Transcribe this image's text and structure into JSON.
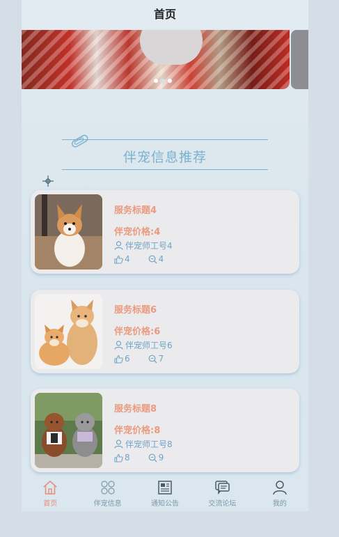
{
  "header": {
    "title": "首页"
  },
  "banner": {
    "slide_count": 3,
    "active_index": 1
  },
  "section": {
    "title": "伴宠信息推荐"
  },
  "cards": [
    {
      "title": "服务标题4",
      "price": "伴宠价格:4",
      "staff": "伴宠师工号4",
      "likes": "4",
      "views": "4",
      "image": "corgi-photo"
    },
    {
      "title": "服务标题6",
      "price": "伴宠价格:6",
      "staff": "伴宠师工号6",
      "likes": "6",
      "views": "7",
      "image": "kittens-photo"
    },
    {
      "title": "服务标题8",
      "price": "伴宠价格:8",
      "staff": "伴宠师工号8",
      "likes": "8",
      "views": "9",
      "image": "poodles-photo"
    }
  ],
  "tabbar": {
    "items": [
      {
        "label": "首页",
        "icon": "home-icon",
        "active": true
      },
      {
        "label": "伴宠信息",
        "icon": "grid-icon",
        "active": false
      },
      {
        "label": "通知公告",
        "icon": "newspaper-icon",
        "active": false
      },
      {
        "label": "交流论坛",
        "icon": "chat-icon",
        "active": false
      },
      {
        "label": "我的",
        "icon": "user-icon",
        "active": false
      }
    ]
  },
  "colors": {
    "accent": "#ea9a7f",
    "info": "#6fa4c4",
    "title_blue": "#7ab2cf",
    "tab_active": "#e4907a"
  }
}
